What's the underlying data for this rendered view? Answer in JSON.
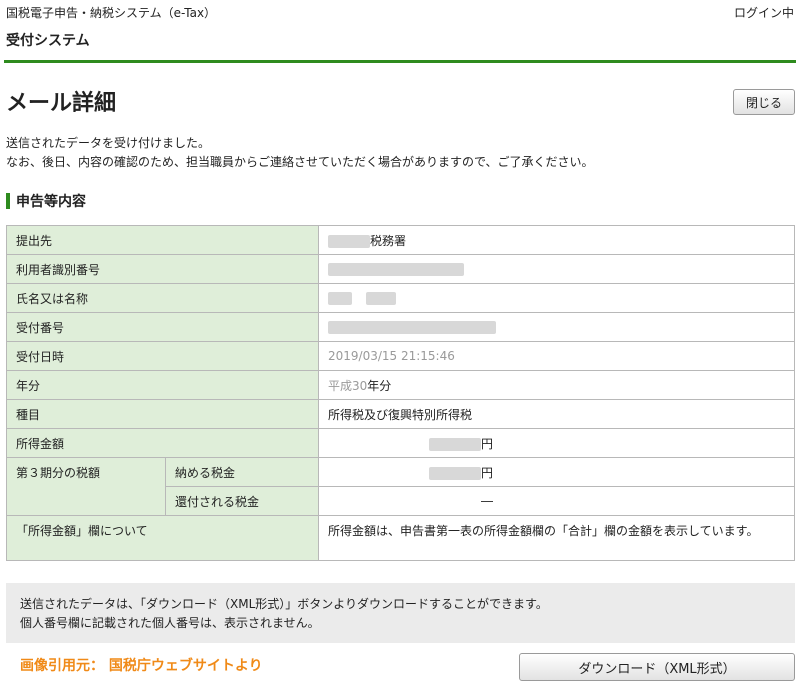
{
  "header": {
    "system_name": "国税電子申告・納税システム（e-Tax）",
    "login_status": "ログイン中",
    "subsystem": "受付システム"
  },
  "page": {
    "title": "メール詳細",
    "close_label": "閉じる"
  },
  "message": {
    "line1": "送信されたデータを受け付けました。",
    "line2": "なお、後日、内容の確認のため、担当職員からご連絡させていただく場合がありますので、ご了承ください。"
  },
  "section": {
    "title": "申告等内容"
  },
  "details": {
    "submit_to_label": "提出先",
    "submit_to_suffix": "税務署",
    "user_id_label": "利用者識別番号",
    "name_label": "氏名又は名称",
    "receipt_no_label": "受付番号",
    "receipt_datetime_label": "受付日時",
    "receipt_datetime_value": "2019/03/15 21:15:46",
    "year_label": "年分",
    "year_era": "平成",
    "year_number": "30",
    "year_suffix": "年分",
    "type_label": "種目",
    "type_value": "所得税及び復興特別所得税",
    "income_label": "所得金額",
    "yen": "円",
    "tax3_label": "第３期分の税額",
    "tax_payable_label": "納める税金",
    "tax_refund_label": "還付される税金",
    "tax_refund_value": "―",
    "note_label": "「所得金額」欄について",
    "note_value": "所得金額は、申告書第一表の所得金額欄の「合計」欄の金額を表示しています。"
  },
  "footer": {
    "line1": "送信されたデータは、「ダウンロード（XML形式）」ボタンよりダウンロードすることができます。",
    "line2": "個人番号欄に記載された個人番号は、表示されません。",
    "credit": "画像引用元： 国税庁ウェブサイトより",
    "download_label": "ダウンロード（XML形式）"
  },
  "colors": {
    "accent_green": "#2e8b1e",
    "label_bg": "#dfeed9",
    "credit_orange": "#f08a18"
  }
}
